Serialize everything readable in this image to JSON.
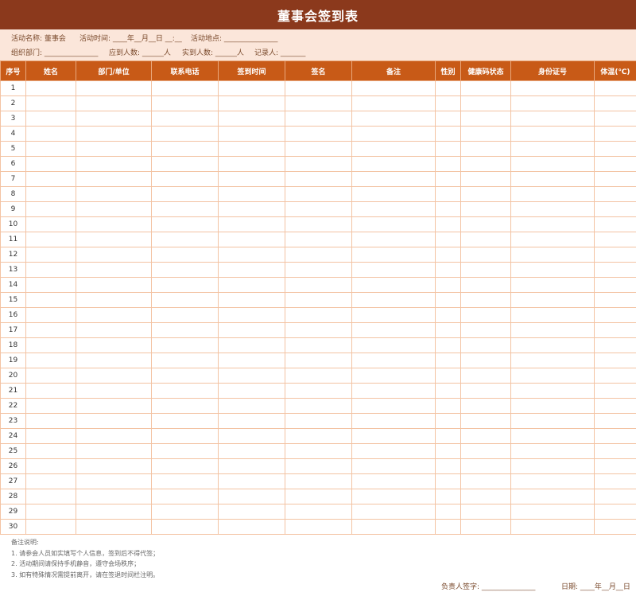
{
  "title": "董事会签到表",
  "info": {
    "row1": [
      {
        "key": "activity_name",
        "text": "活动名称:  董事会"
      },
      {
        "key": "activity_time",
        "text": "活动时间: ____年__月__日  __:__"
      },
      {
        "key": "activity_place",
        "text": "活动地点: _______________"
      }
    ],
    "row2": [
      {
        "key": "organizer",
        "text": "组织部门: _______________"
      },
      {
        "key": "expected",
        "text": "应到人数: ______人"
      },
      {
        "key": "actual",
        "text": "实到人数: ______人"
      },
      {
        "key": "recorder",
        "text": "记录人: _______"
      }
    ]
  },
  "table": {
    "headers": [
      "序号",
      "姓名",
      "部门/单位",
      "联系电话",
      "签到时间",
      "签名",
      "备注",
      "性别",
      "健康码状态",
      "身份证号",
      "体温(℃)"
    ],
    "rows": [
      "1",
      "2",
      "3",
      "4",
      "5",
      "6",
      "7",
      "8",
      "9",
      "10",
      "11",
      "12",
      "13",
      "14",
      "15",
      "16",
      "17",
      "18",
      "19",
      "20",
      "21",
      "22",
      "23",
      "24",
      "25",
      "26",
      "27",
      "28",
      "29",
      "30"
    ]
  },
  "notes": {
    "heading": "备注说明:",
    "items": [
      "1. 请参会人员如实填写个人信息，签到后不得代签；",
      "2. 活动期间请保持手机静音，遵守会场秩序；",
      "3. 如有特殊情况需提前离开，请在签退时间栏注明。"
    ]
  },
  "footer": {
    "signature": "负责人签字: _______________",
    "date": "日期: ____年__月__日"
  },
  "colors": {
    "title_bg": "#8b391c",
    "info_bg": "#fbe6da",
    "header_bg": "#c85a17",
    "grid": "#f3c3a3"
  }
}
